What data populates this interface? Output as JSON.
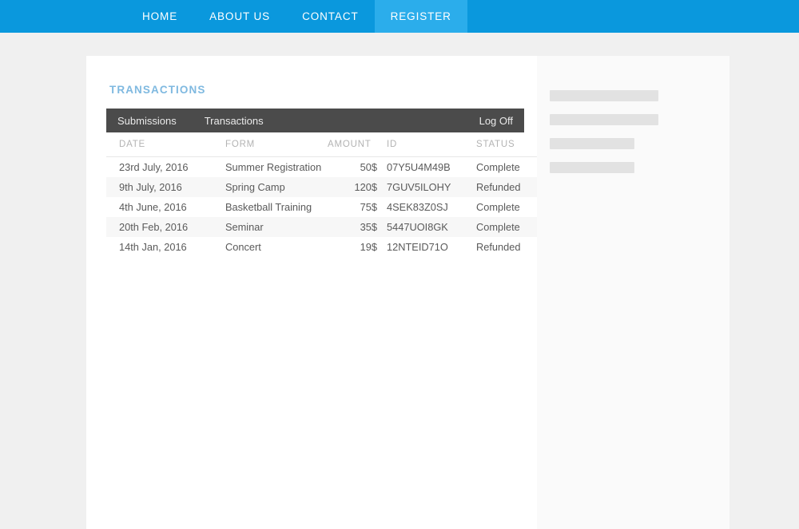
{
  "theme": {
    "nav_blue": "#0a98dd",
    "nav_active_blue": "#2badeb",
    "title_blue": "#7fb9e0",
    "tabbar_dark": "#4b4b4b",
    "page_bg": "#f0f0f0",
    "card_bg": "#ffffff",
    "placeholder_gray": "#e2e2e2"
  },
  "nav": {
    "items": [
      {
        "label": "HOME",
        "active": false
      },
      {
        "label": "ABOUT US",
        "active": false
      },
      {
        "label": "CONTACT",
        "active": false
      },
      {
        "label": "REGISTER",
        "active": true
      }
    ]
  },
  "page": {
    "section_title": "TRANSACTIONS"
  },
  "tabbar": {
    "tabs": [
      {
        "label": "Submissions"
      },
      {
        "label": "Transactions"
      }
    ],
    "logoff_label": "Log Off"
  },
  "table": {
    "headers": {
      "date": "DATE",
      "form": "FORM",
      "amount": "AMOUNT",
      "id": "ID",
      "status": "STATUS"
    },
    "rows": [
      {
        "date": "23rd July, 2016",
        "form": "Summer Registration",
        "amount": "50$",
        "id": "07Y5U4M49B",
        "status": "Complete"
      },
      {
        "date": "9th July, 2016",
        "form": "Spring Camp",
        "amount": "120$",
        "id": "7GUV5ILOHY",
        "status": "Refunded"
      },
      {
        "date": "4th June, 2016",
        "form": "Basketball Training",
        "amount": "75$",
        "id": "4SEK83Z0SJ",
        "status": "Complete"
      },
      {
        "date": "20th Feb, 2016",
        "form": "Seminar",
        "amount": "35$",
        "id": "5447UOI8GK",
        "status": "Complete"
      },
      {
        "date": "14th Jan, 2016",
        "form": "Concert",
        "amount": "19$",
        "id": "12NTEID71O",
        "status": "Refunded"
      }
    ]
  },
  "sidebar": {
    "placeholders": [
      {
        "name": "placeholder-bar-1"
      },
      {
        "name": "placeholder-bar-2"
      },
      {
        "name": "placeholder-bar-3"
      },
      {
        "name": "placeholder-bar-4"
      }
    ]
  }
}
